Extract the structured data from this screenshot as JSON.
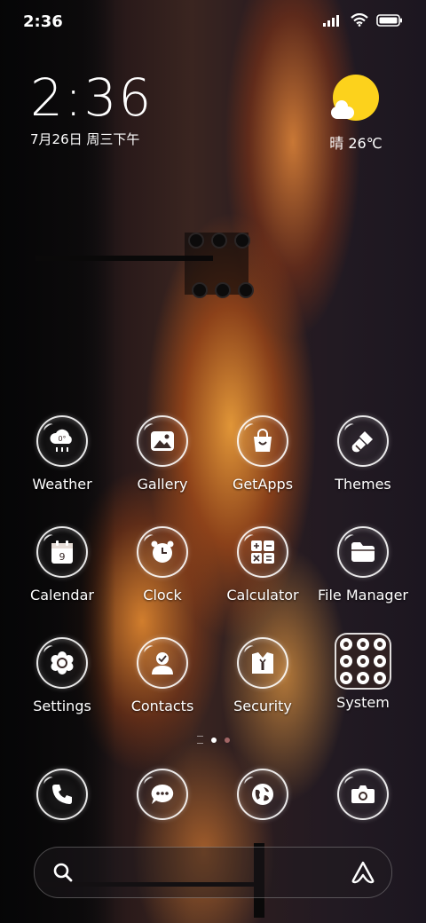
{
  "status_bar": {
    "time": "2:36",
    "icons": [
      "signal-icon",
      "wifi-icon",
      "battery-icon"
    ]
  },
  "clock_widget": {
    "time": "2:36",
    "date": "7月26日 周三下午"
  },
  "weather_widget": {
    "text": "晴 26℃",
    "icon": "sun-cloud-icon"
  },
  "apps": [
    {
      "label": "Weather",
      "icon": "weather-icon"
    },
    {
      "label": "Gallery",
      "icon": "gallery-icon"
    },
    {
      "label": "GetApps",
      "icon": "getapps-icon"
    },
    {
      "label": "Themes",
      "icon": "themes-icon"
    },
    {
      "label": "Calendar",
      "icon": "calendar-icon",
      "icon_text": "9"
    },
    {
      "label": "Clock",
      "icon": "clock-icon"
    },
    {
      "label": "Calculator",
      "icon": "calculator-icon"
    },
    {
      "label": "File Manager",
      "icon": "file-manager-icon"
    },
    {
      "label": "Settings",
      "icon": "settings-icon"
    },
    {
      "label": "Contacts",
      "icon": "contacts-icon"
    },
    {
      "label": "Security",
      "icon": "security-icon"
    },
    {
      "label": "System",
      "icon": "system-folder-icon"
    }
  ],
  "weather_icon_text": "0°",
  "page_indicator": {
    "pages": 2,
    "active": 1
  },
  "dock": [
    {
      "icon": "phone-icon"
    },
    {
      "icon": "messages-icon"
    },
    {
      "icon": "browser-icon"
    },
    {
      "icon": "camera-icon"
    }
  ],
  "search_bar": {
    "left_icon": "search-icon",
    "right_icon": "assistant-icon"
  },
  "colors": {
    "weather_sun": "#fcd21c",
    "icon_outline": "#ffffff"
  }
}
